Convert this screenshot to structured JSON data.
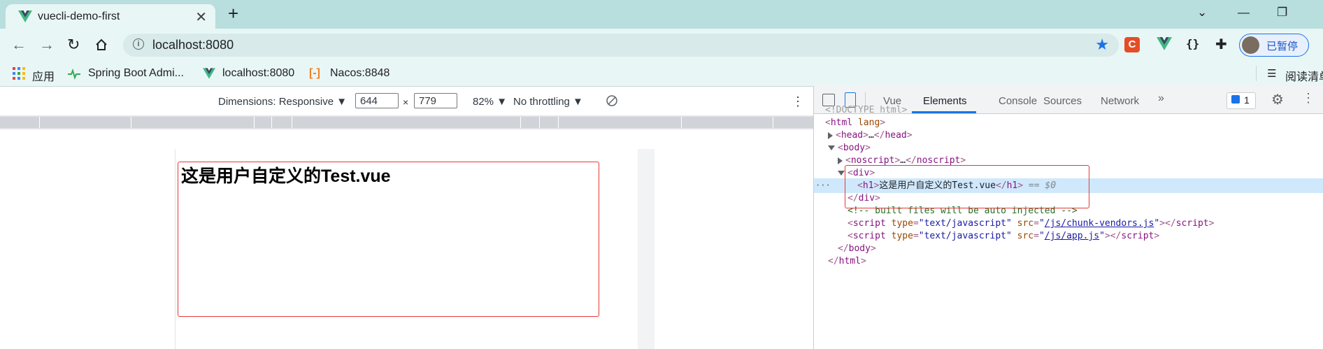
{
  "browser": {
    "tab_title": "vuecli-demo-first",
    "new_tab": "+",
    "address": "localhost:8080",
    "profile_status": "已暂停",
    "ext_json": "{}"
  },
  "bookmarks": [
    {
      "label": "应用",
      "icon": "apps-grid-icon"
    },
    {
      "label": "Spring Boot Admi...",
      "icon": "spring-boot-admin-icon"
    },
    {
      "label": "localhost:8080",
      "icon": "vue-logo-icon"
    },
    {
      "label": "Nacos:8848",
      "icon": "nacos-icon"
    },
    {
      "label": "阅读清单",
      "icon": "reading-list-icon"
    }
  ],
  "device_toolbar": {
    "dimensions_label": "Dimensions: Responsive ▼",
    "width": "644",
    "times": "×",
    "height": "779",
    "zoom": "82% ▼",
    "throttling": "No throttling ▼"
  },
  "page": {
    "heading": "这是用户自定义的Test.vue"
  },
  "devtools": {
    "tabs": [
      "Vue",
      "Elements",
      "Console",
      "Sources",
      "Network"
    ],
    "active_tab": "Elements",
    "more": "»",
    "issues_count": "1"
  },
  "dom": {
    "doctype": "<!DOCTYPE html>",
    "html_open": "html",
    "html_attr": "lang",
    "head": "head",
    "ellipsis": "…",
    "body": "body",
    "noscript": "noscript",
    "div": "div",
    "h1": "h1",
    "h1_text": "这是用户自定义的Test.vue",
    "selected_marker": "== $0",
    "comment": "<!-- built files will be auto injected -->",
    "script": "script",
    "type_attr": "type",
    "type_val": "\"text/javascript\"",
    "src_attr": "src",
    "src1": "/js/chunk-vendors.js",
    "src2": "/js/app.js",
    "quote": "\"",
    "row_dots": "···"
  },
  "colors": {
    "tab_strip": "#b8dede",
    "accent": "#1a73e8",
    "highlight_border": "#e53935"
  }
}
